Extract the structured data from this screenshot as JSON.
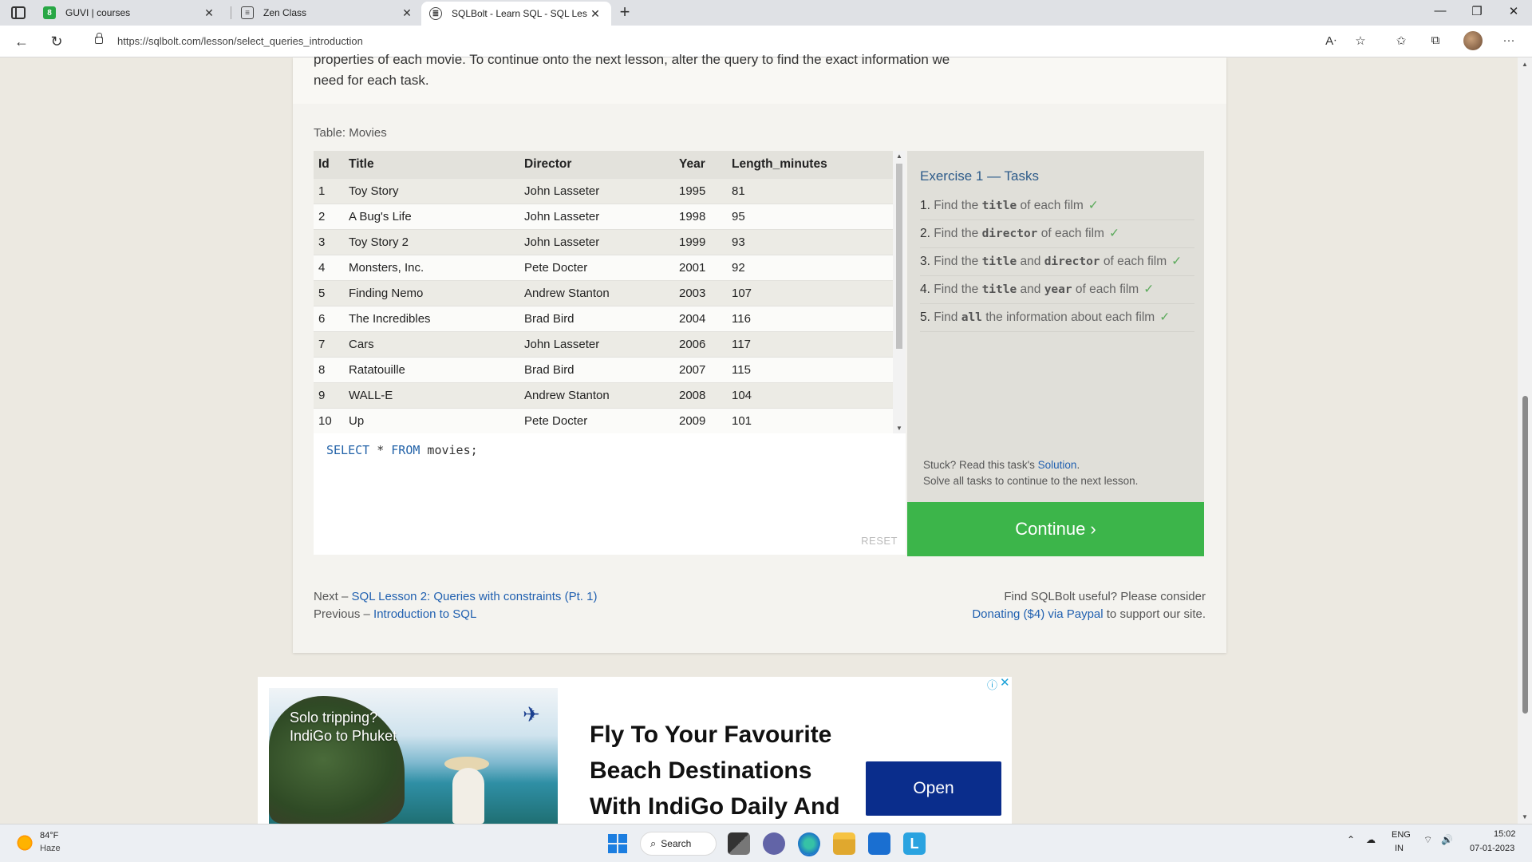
{
  "browser": {
    "tabs": [
      {
        "label": "GUVI | courses",
        "favicon": "guvi-icon"
      },
      {
        "label": "Zen Class",
        "favicon": "page-icon"
      },
      {
        "label": "SQLBolt - Learn SQL - SQL Lesso",
        "favicon": "sqlbolt-icon"
      }
    ],
    "url": "https://sqlbolt.com/lesson/select_queries_introduction"
  },
  "lesson": {
    "intro_line1": "properties of each movie. To continue onto the next lesson, alter the query to find the exact information we",
    "intro_line2": "need for each task.",
    "table_caption": "Table: Movies",
    "columns": [
      "Id",
      "Title",
      "Director",
      "Year",
      "Length_minutes"
    ],
    "rows": [
      [
        "1",
        "Toy Story",
        "John Lasseter",
        "1995",
        "81"
      ],
      [
        "2",
        "A Bug's Life",
        "John Lasseter",
        "1998",
        "95"
      ],
      [
        "3",
        "Toy Story 2",
        "John Lasseter",
        "1999",
        "93"
      ],
      [
        "4",
        "Monsters, Inc.",
        "Pete Docter",
        "2001",
        "92"
      ],
      [
        "5",
        "Finding Nemo",
        "Andrew Stanton",
        "2003",
        "107"
      ],
      [
        "6",
        "The Incredibles",
        "Brad Bird",
        "2004",
        "116"
      ],
      [
        "7",
        "Cars",
        "John Lasseter",
        "2006",
        "117"
      ],
      [
        "8",
        "Ratatouille",
        "Brad Bird",
        "2007",
        "115"
      ],
      [
        "9",
        "WALL-E",
        "Andrew Stanton",
        "2008",
        "104"
      ],
      [
        "10",
        "Up",
        "Pete Docter",
        "2009",
        "101"
      ]
    ],
    "query": {
      "kw1": "SELECT",
      "star": " * ",
      "kw2": "FROM",
      "rest": " movies;"
    },
    "reset_label": "RESET"
  },
  "exercise": {
    "title": "Exercise 1 — Tasks",
    "tasks": [
      {
        "num": "1.",
        "pre": "Find the ",
        "code": "title",
        "post": " of each film",
        "check": "✓"
      },
      {
        "num": "2.",
        "pre": "Find the ",
        "code": "director",
        "post": " of each film",
        "check": "✓"
      },
      {
        "num": "3.",
        "pre": "Find the ",
        "code": "title",
        "mid": " and ",
        "code2": "director",
        "post": " of each film",
        "check": "✓"
      },
      {
        "num": "4.",
        "pre": "Find the ",
        "code": "title",
        "mid": " and ",
        "code2": "year",
        "post": " of each film",
        "check": "✓"
      },
      {
        "num": "5.",
        "pre": "Find ",
        "code": "all",
        "post": " the information about each film",
        "check": "✓"
      }
    ],
    "stuck_prefix": "Stuck? Read this task's ",
    "solution_link": "Solution",
    "stuck_suffix": ".",
    "solve_all": "Solve all tasks to continue to the next lesson.",
    "continue_label": "Continue ›"
  },
  "footer": {
    "next_prefix": "Next – ",
    "next_link": "SQL Lesson 2: Queries with constraints (Pt. 1)",
    "prev_prefix": "Previous – ",
    "prev_link": "Introduction to SQL",
    "support_line1": "Find SQLBolt useful? Please consider",
    "donate_link": "Donating ($4) via Paypal",
    "support_suffix": " to support our site."
  },
  "ad": {
    "tagline1": "Solo tripping?",
    "tagline2": "IndiGo to Phuket",
    "headline": "Fly To Your Favourite Beach Destinations With IndiGo Daily And",
    "open_label": "Open"
  },
  "taskbar": {
    "temp": "84°F",
    "weather": "Haze",
    "search_label": "Search",
    "lang1": "ENG",
    "lang2": "IN",
    "time": "15:02",
    "date": "07-01-2023"
  },
  "colors": {
    "continue_green": "#3cb54a",
    "link_blue": "#2060b0",
    "ad_button": "#0a2d8c"
  }
}
